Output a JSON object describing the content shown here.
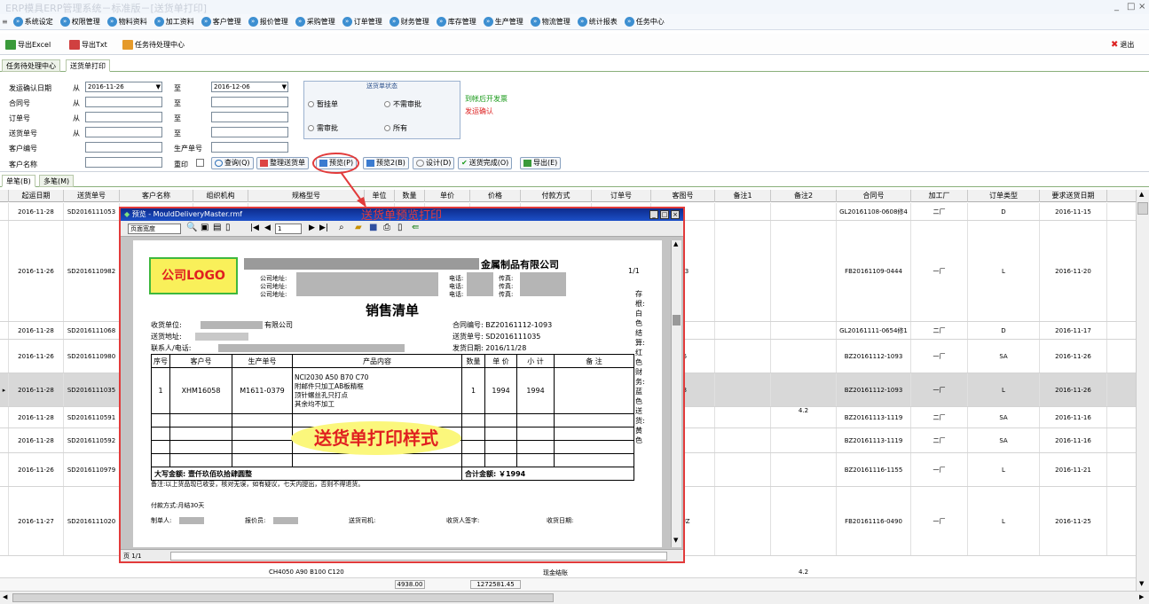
{
  "window": {
    "title": "ERP模具ERP管理系统－标准版－[送货单打印]",
    "controls": [
      "_",
      "□",
      "×"
    ]
  },
  "menu": [
    "系统设定",
    "权限管理",
    "物料资料",
    "加工资料",
    "客户管理",
    "报价管理",
    "采购管理",
    "订单管理",
    "财务管理",
    "库存管理",
    "生产管理",
    "物流管理",
    "统计报表",
    "任务中心"
  ],
  "toolbar": {
    "export_excel": "导出Excel",
    "export_txt": "导出Txt",
    "task_center": "任务待处理中心",
    "exit": "退出"
  },
  "tabs": [
    "任务待处理中心",
    "送货单打印"
  ],
  "filter": {
    "labels": [
      "发运确认日期",
      "合同号",
      "订单号",
      "送货单号",
      "客户编号",
      "客户名称"
    ],
    "from": "从",
    "to": "至",
    "date_from": "2016-11-26",
    "date_to": "2016-12-06",
    "production_no": "生产单号",
    "reprint": "重印",
    "status_group": {
      "title": "送货单状态",
      "options": [
        "暂挂单",
        "不需审批",
        "需审批",
        "所有"
      ]
    },
    "note_invoice": "到帐后开发票",
    "note_ship": "发运确认",
    "buttons": [
      "查询(Q)",
      "整理送货单",
      "预览(P)",
      "预览2(B)",
      "设计(D)",
      "送货完成(O)",
      "导出(E)"
    ]
  },
  "page_tabs": [
    "单笔(B)",
    "多笔(M)"
  ],
  "grid": {
    "headers": [
      "起运日期",
      "送货单号",
      "客户名称",
      "组织机构",
      "规格型号",
      "单位",
      "数量",
      "单价",
      "价格",
      "付款方式",
      "订单号",
      "客图号",
      "备注1",
      "备注2",
      "合同号",
      "加工厂",
      "订单类型",
      "要求送货日期"
    ],
    "rows": [
      [
        "2016-11-28",
        "SD2016111053",
        "",
        "",
        "",
        "",
        "",
        "",
        "",
        "",
        "",
        "",
        "",
        "",
        "GL20161108-0608修4",
        "二厂",
        "D",
        "2016-11-15"
      ],
      [
        "2016-11-26",
        "SD2016110982",
        "",
        "",
        "",
        "",
        "",
        "",
        "",
        "",
        "",
        "493",
        "",
        "",
        "FB20161109-0444",
        "一厂",
        "L",
        "2016-11-20"
      ],
      [
        "2016-11-28",
        "SD2016111068",
        "",
        "",
        "",
        "",
        "",
        "",
        "",
        "",
        "",
        "",
        "",
        "",
        "GL20161111-0654修1",
        "二厂",
        "D",
        "2016-11-17"
      ],
      [
        "2016-11-26",
        "SD2016110980",
        "",
        "",
        "",
        "",
        "",
        "",
        "",
        "",
        "",
        "56",
        "",
        "",
        "BZ20161112-1093",
        "一厂",
        "SA",
        "2016-11-26"
      ],
      [
        "2016-11-28",
        "SD2016111035",
        "",
        "",
        "",
        "",
        "",
        "",
        "",
        "",
        "",
        "58",
        "",
        "",
        "BZ20161112-1093",
        "一厂",
        "L",
        "2016-11-26"
      ],
      [
        "2016-11-28",
        "SD2016110591",
        "",
        "",
        "",
        "",
        "",
        "",
        "",
        "",
        "",
        "",
        "",
        "4.2",
        "BZ20161113-1119",
        "二厂",
        "SA",
        "2016-11-16"
      ],
      [
        "2016-11-28",
        "SD2016110592",
        "",
        "",
        "",
        "",
        "",
        "",
        "",
        "",
        "",
        "",
        "",
        "",
        "BZ20161113-1119",
        "二厂",
        "SA",
        "2016-11-16"
      ],
      [
        "2016-11-26",
        "SD2016110979",
        "",
        "",
        "",
        "",
        "",
        "",
        "",
        "",
        "",
        "9",
        "",
        "",
        "BZ20161116-1155",
        "一厂",
        "L",
        "2016-11-21"
      ],
      [
        "2016-11-27",
        "SD2016111020",
        "",
        "",
        "",
        "",
        "",
        "",
        "",
        "",
        "",
        "ITUZ",
        "",
        "",
        "FB20161116-0490",
        "一厂",
        "L",
        "2016-11-25"
      ]
    ],
    "footer_row": {
      "spec": "CH4050 A90 B100 C120",
      "payment": "现金结账",
      "remark2": "4.2"
    },
    "totals": {
      "qty": "4938.00",
      "amount": "1272581.45"
    }
  },
  "preview": {
    "title": "预览 - MouldDeliveryMaster.rmf",
    "annotation": "送货单预览打印",
    "zoom": "页面宽度",
    "page_input": "1",
    "status": "页 1/1",
    "doc": {
      "logo": "公司LOGO",
      "company_suffix": "金属制品有限公司",
      "addr": "公司地址:",
      "phone": "电话:",
      "fax": "传真:",
      "page_no": "1/1",
      "heading": "销售清单",
      "receiver": "收货单位:",
      "receiver_suffix": "有限公司",
      "ship_addr": "送货地址:",
      "contact": "联系人/电话:",
      "contract": "合同编号: BZ20161112-1093",
      "ship_no": "送货单号: SD2016111035",
      "ship_date": "发货日期: 2016/11/28",
      "cols": [
        "序号",
        "客户号",
        "生产单号",
        "产品内容",
        "数量",
        "单 价",
        "小 计",
        "备 注"
      ],
      "item": {
        "no": "1",
        "cust": "XHM16058",
        "prod": "M1611-0379",
        "content": [
          "NCI2030 A50 B70 C70",
          "附邮件只加工AB板精框",
          "顶针螺丝孔只打点",
          "其余均不加工"
        ],
        "qty": "1",
        "price": "1994",
        "subtotal": "1994"
      },
      "watermark": "送货单打印样式",
      "amount_words": "大写金额: 壹仟玖佰玖拾肆圆整",
      "total": "合计金额: ￥1994",
      "note": "备注:以上货品现已收妥，核对无误，如有疑议，七天内提出，否则不得退货。",
      "payment": "付款方式:月结30天",
      "maker": "制单人:",
      "quoter": "报价员:",
      "driver": "送货司机:",
      "signer": "收货人签字:",
      "recv_date": "收货日期:",
      "side": "存根:白色  结算:红色  财务:蓝色  送货:黄色"
    }
  }
}
